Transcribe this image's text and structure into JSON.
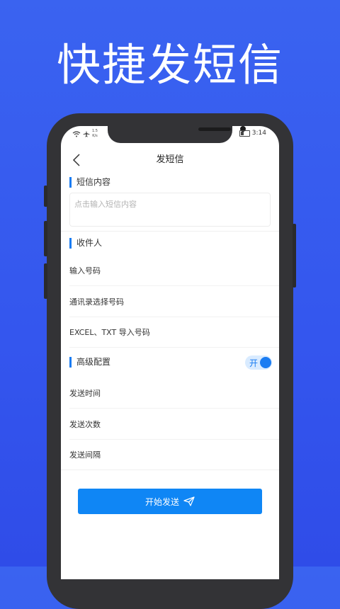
{
  "promo": {
    "title": "快捷发短信"
  },
  "status_bar": {
    "speed_value": "1.5",
    "speed_unit": "K/s",
    "time": "3:14"
  },
  "nav": {
    "title": "发短信"
  },
  "sms_content": {
    "label": "短信内容",
    "placeholder": "点击输入短信内容"
  },
  "recipients": {
    "label": "收件人",
    "options": [
      {
        "label": "输入号码"
      },
      {
        "label": "通讯录选择号码"
      },
      {
        "label": "EXCEL、TXT 导入号码"
      }
    ]
  },
  "advanced": {
    "label": "高级配置",
    "toggle_text": "开",
    "toggle_on": true,
    "options": [
      {
        "label": "发送时间"
      },
      {
        "label": "发送次数"
      },
      {
        "label": "发送间隔"
      }
    ]
  },
  "start_button": {
    "label": "开始发送",
    "icon": "send-icon"
  },
  "colors": {
    "accent": "#1a7cf2",
    "button": "#0f86f5",
    "background": "#3a5ff0"
  }
}
